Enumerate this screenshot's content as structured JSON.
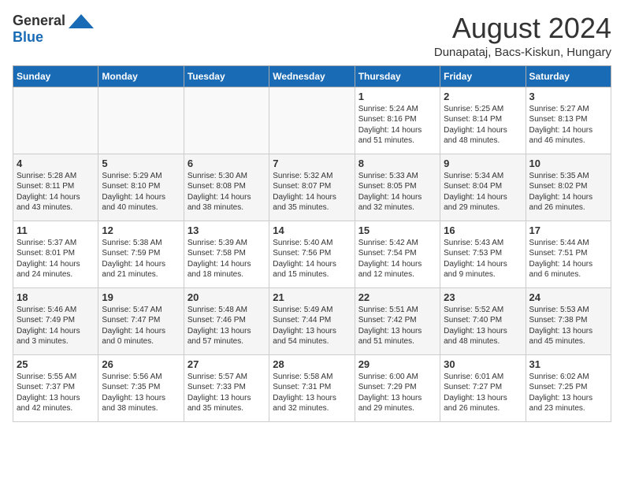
{
  "logo": {
    "general": "General",
    "blue": "Blue"
  },
  "title": {
    "month": "August 2024",
    "location": "Dunapataj, Bacs-Kiskun, Hungary"
  },
  "headers": [
    "Sunday",
    "Monday",
    "Tuesday",
    "Wednesday",
    "Thursday",
    "Friday",
    "Saturday"
  ],
  "weeks": [
    [
      {
        "day": "",
        "content": ""
      },
      {
        "day": "",
        "content": ""
      },
      {
        "day": "",
        "content": ""
      },
      {
        "day": "",
        "content": ""
      },
      {
        "day": "1",
        "content": "Sunrise: 5:24 AM\nSunset: 8:16 PM\nDaylight: 14 hours\nand 51 minutes."
      },
      {
        "day": "2",
        "content": "Sunrise: 5:25 AM\nSunset: 8:14 PM\nDaylight: 14 hours\nand 48 minutes."
      },
      {
        "day": "3",
        "content": "Sunrise: 5:27 AM\nSunset: 8:13 PM\nDaylight: 14 hours\nand 46 minutes."
      }
    ],
    [
      {
        "day": "4",
        "content": "Sunrise: 5:28 AM\nSunset: 8:11 PM\nDaylight: 14 hours\nand 43 minutes."
      },
      {
        "day": "5",
        "content": "Sunrise: 5:29 AM\nSunset: 8:10 PM\nDaylight: 14 hours\nand 40 minutes."
      },
      {
        "day": "6",
        "content": "Sunrise: 5:30 AM\nSunset: 8:08 PM\nDaylight: 14 hours\nand 38 minutes."
      },
      {
        "day": "7",
        "content": "Sunrise: 5:32 AM\nSunset: 8:07 PM\nDaylight: 14 hours\nand 35 minutes."
      },
      {
        "day": "8",
        "content": "Sunrise: 5:33 AM\nSunset: 8:05 PM\nDaylight: 14 hours\nand 32 minutes."
      },
      {
        "day": "9",
        "content": "Sunrise: 5:34 AM\nSunset: 8:04 PM\nDaylight: 14 hours\nand 29 minutes."
      },
      {
        "day": "10",
        "content": "Sunrise: 5:35 AM\nSunset: 8:02 PM\nDaylight: 14 hours\nand 26 minutes."
      }
    ],
    [
      {
        "day": "11",
        "content": "Sunrise: 5:37 AM\nSunset: 8:01 PM\nDaylight: 14 hours\nand 24 minutes."
      },
      {
        "day": "12",
        "content": "Sunrise: 5:38 AM\nSunset: 7:59 PM\nDaylight: 14 hours\nand 21 minutes."
      },
      {
        "day": "13",
        "content": "Sunrise: 5:39 AM\nSunset: 7:58 PM\nDaylight: 14 hours\nand 18 minutes."
      },
      {
        "day": "14",
        "content": "Sunrise: 5:40 AM\nSunset: 7:56 PM\nDaylight: 14 hours\nand 15 minutes."
      },
      {
        "day": "15",
        "content": "Sunrise: 5:42 AM\nSunset: 7:54 PM\nDaylight: 14 hours\nand 12 minutes."
      },
      {
        "day": "16",
        "content": "Sunrise: 5:43 AM\nSunset: 7:53 PM\nDaylight: 14 hours\nand 9 minutes."
      },
      {
        "day": "17",
        "content": "Sunrise: 5:44 AM\nSunset: 7:51 PM\nDaylight: 14 hours\nand 6 minutes."
      }
    ],
    [
      {
        "day": "18",
        "content": "Sunrise: 5:46 AM\nSunset: 7:49 PM\nDaylight: 14 hours\nand 3 minutes."
      },
      {
        "day": "19",
        "content": "Sunrise: 5:47 AM\nSunset: 7:47 PM\nDaylight: 14 hours\nand 0 minutes."
      },
      {
        "day": "20",
        "content": "Sunrise: 5:48 AM\nSunset: 7:46 PM\nDaylight: 13 hours\nand 57 minutes."
      },
      {
        "day": "21",
        "content": "Sunrise: 5:49 AM\nSunset: 7:44 PM\nDaylight: 13 hours\nand 54 minutes."
      },
      {
        "day": "22",
        "content": "Sunrise: 5:51 AM\nSunset: 7:42 PM\nDaylight: 13 hours\nand 51 minutes."
      },
      {
        "day": "23",
        "content": "Sunrise: 5:52 AM\nSunset: 7:40 PM\nDaylight: 13 hours\nand 48 minutes."
      },
      {
        "day": "24",
        "content": "Sunrise: 5:53 AM\nSunset: 7:38 PM\nDaylight: 13 hours\nand 45 minutes."
      }
    ],
    [
      {
        "day": "25",
        "content": "Sunrise: 5:55 AM\nSunset: 7:37 PM\nDaylight: 13 hours\nand 42 minutes."
      },
      {
        "day": "26",
        "content": "Sunrise: 5:56 AM\nSunset: 7:35 PM\nDaylight: 13 hours\nand 38 minutes."
      },
      {
        "day": "27",
        "content": "Sunrise: 5:57 AM\nSunset: 7:33 PM\nDaylight: 13 hours\nand 35 minutes."
      },
      {
        "day": "28",
        "content": "Sunrise: 5:58 AM\nSunset: 7:31 PM\nDaylight: 13 hours\nand 32 minutes."
      },
      {
        "day": "29",
        "content": "Sunrise: 6:00 AM\nSunset: 7:29 PM\nDaylight: 13 hours\nand 29 minutes."
      },
      {
        "day": "30",
        "content": "Sunrise: 6:01 AM\nSunset: 7:27 PM\nDaylight: 13 hours\nand 26 minutes."
      },
      {
        "day": "31",
        "content": "Sunrise: 6:02 AM\nSunset: 7:25 PM\nDaylight: 13 hours\nand 23 minutes."
      }
    ]
  ]
}
